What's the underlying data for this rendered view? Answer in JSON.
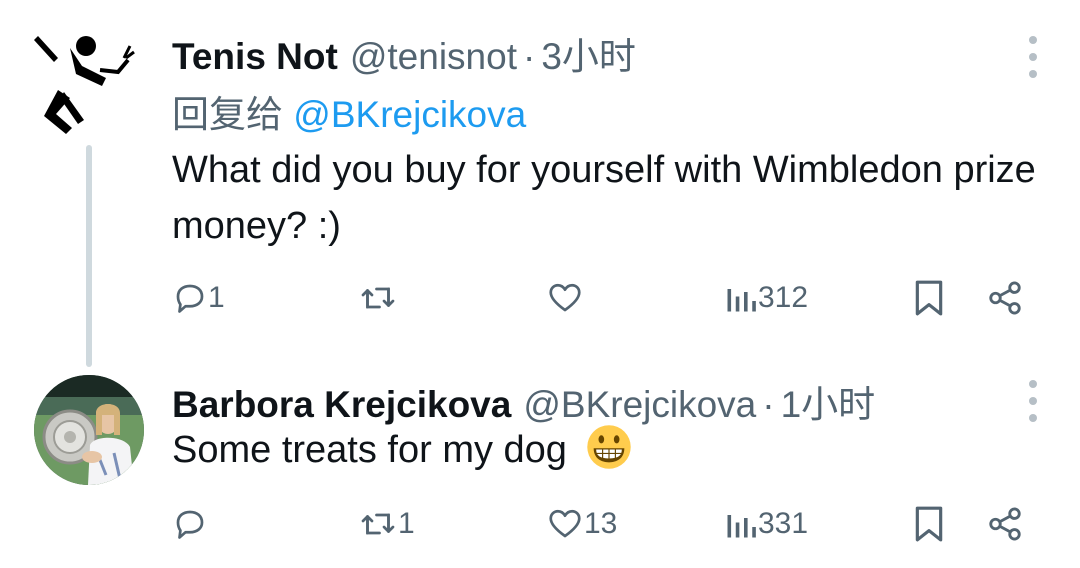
{
  "tweets": [
    {
      "name": "Tenis Not",
      "handle": "@tenisnot",
      "separator": "·",
      "time": "3小时",
      "reply_prefix": "回复给",
      "reply_mention": "@BKrejcikova",
      "text": "What did you buy for yourself with Wimbledon prize money? :)",
      "avatar_icon": "tennis-player-logo-icon",
      "actions": {
        "replies": "1",
        "retweets": "",
        "likes": "",
        "views": "312"
      }
    },
    {
      "name": "Barbora Krejcikova",
      "handle": "@BKrejcikova",
      "separator": "·",
      "time": "1小时",
      "text": "Some treats for my dog",
      "text_emoji": "grinning-face-emoji",
      "avatar_icon": "profile-photo-trophy",
      "actions": {
        "replies": "",
        "retweets": "1",
        "likes": "13",
        "views": "331"
      }
    }
  ],
  "colors": {
    "text": "#0f1419",
    "secondary": "#536471",
    "link": "#1d9bf0",
    "thread_line": "#cfd9de"
  }
}
